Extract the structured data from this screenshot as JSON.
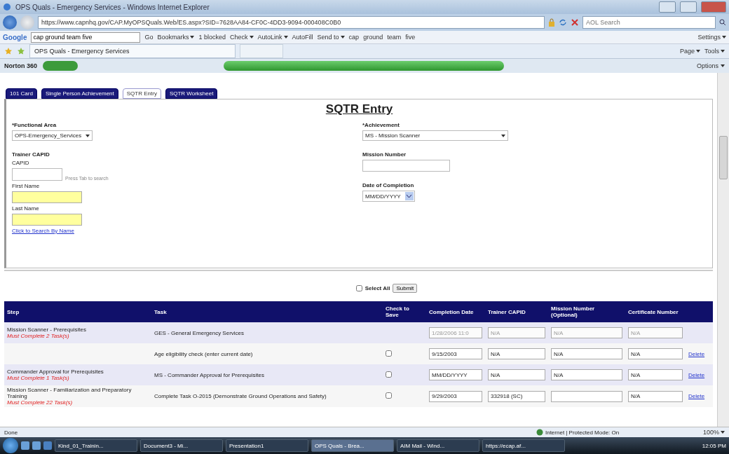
{
  "window": {
    "title": "OPS Quals - Emergency Services - Windows Internet Explorer"
  },
  "address_bar": {
    "url": "https://www.capnhq.gov/CAP.MyOPSQuals.Web/ES.aspx?SID=7628AA84-CF0C-4DD3-9094-000408C0B0",
    "search": {
      "placeholder": "AOL Search"
    }
  },
  "google_toolbar": {
    "logo": "Google",
    "query": "cap ground team five",
    "go": "Go",
    "items": [
      {
        "label": "Bookmarks",
        "dropdown": true
      },
      {
        "label": "1 blocked",
        "dropdown": false
      },
      {
        "label": "Check",
        "dropdown": true
      },
      {
        "label": "AutoLink",
        "dropdown": true
      },
      {
        "label": "AutoFill",
        "dropdown": false
      },
      {
        "label": "Send to",
        "dropdown": true
      },
      {
        "label": "cap",
        "dropdown": false
      },
      {
        "label": "ground",
        "dropdown": false
      },
      {
        "label": "team",
        "dropdown": false
      },
      {
        "label": "five",
        "dropdown": false
      }
    ],
    "settings": "Settings"
  },
  "favorites_bar": {
    "tab": "OPS Quals - Emergency Services",
    "tools": [
      "Page",
      "Tools"
    ]
  },
  "norton_bar": {
    "brand": "Norton 360",
    "options": "Options"
  },
  "page": {
    "tabs": [
      {
        "label": "101 Card",
        "selected": false
      },
      {
        "label": "Single Person Achievement",
        "selected": false
      },
      {
        "label": "SQTR Entry",
        "selected": true
      },
      {
        "label": "SQTR Worksheet",
        "selected": false
      }
    ],
    "heading": "SQTR Entry",
    "form": {
      "functional_area": {
        "label": "*Functional Area",
        "value": "OPS-Emergency_Services"
      },
      "trainer": {
        "heading": "Trainer CAPID",
        "capid_label": "CAPID",
        "hint": "Press Tab to search",
        "first_name_label": "First Name",
        "last_name_label": "Last Name",
        "link": "Click to Search By Name"
      },
      "achievement": {
        "label": "*Achievement",
        "value": "MS - Mission Scanner"
      },
      "mission_number": {
        "label": "Mission Number"
      },
      "date": {
        "label": "Date of Completion",
        "value": "MM/DD/YYYY"
      }
    },
    "select_all": {
      "label": "Select All",
      "checked": false
    },
    "submit": "Submit",
    "table": {
      "columns": [
        "Step",
        "Task",
        "Check to Save",
        "Completion Date",
        "Trainer CAPID",
        "Mission Number (Optional)",
        "Certificate Number"
      ],
      "rows": [
        {
          "kind": "locked",
          "step": "Mission Scanner - Prerequisites",
          "requirement": "Must Complete 2 Task(s)",
          "task": "GES - General Emergency Services",
          "completion_date": "1/28/2006 11:0",
          "trainer_capid": "N/A",
          "mission_number": "N/A",
          "certificate_number": "N/A"
        },
        {
          "kind": "editable",
          "task": "Age eligibility check (enter current date)",
          "checked": false,
          "completion_date": "9/15/2003",
          "trainer_capid": "N/A",
          "mission_number": "N/A",
          "certificate_number": "N/A",
          "action": "Delete"
        },
        {
          "kind": "editable",
          "step": "Commander Approval for Prerequisites",
          "requirement": "Must Complete 1 Task(s)",
          "task": "MS - Commander Approval for Prerequisites",
          "checked": false,
          "completion_date": "MM/DD/YYYY",
          "trainer_capid": "N/A",
          "mission_number": "N/A",
          "certificate_number": "N/A",
          "action": "Delete"
        },
        {
          "kind": "editable",
          "step": "Mission Scanner - Familiarization and Preparatory Training",
          "requirement": "Must Complete 22 Task(s)",
          "task": "Complete Task O-2015 (Demonstrate Ground Operations and Safety)",
          "checked": false,
          "completion_date": "9/29/2003",
          "trainer_capid": "332918 (SC)",
          "certificate_number": "N/A",
          "action": "Delete"
        }
      ]
    }
  },
  "status_bar": {
    "status": "Done",
    "zone": "Internet | Protected Mode: On",
    "zoom": "100%"
  },
  "taskbar": {
    "buttons": [
      {
        "label": "Kind_01_Trainin...",
        "selected": false
      },
      {
        "label": "Document3 - Mi...",
        "selected": false
      },
      {
        "label": "Presentation1",
        "selected": false
      },
      {
        "label": "OPS Quals - Brea...",
        "selected": true
      },
      {
        "label": "AIM Mail - Wind...",
        "selected": false
      },
      {
        "label": "https://ecap.af...",
        "selected": false
      }
    ],
    "clock": "12:05 PM"
  }
}
